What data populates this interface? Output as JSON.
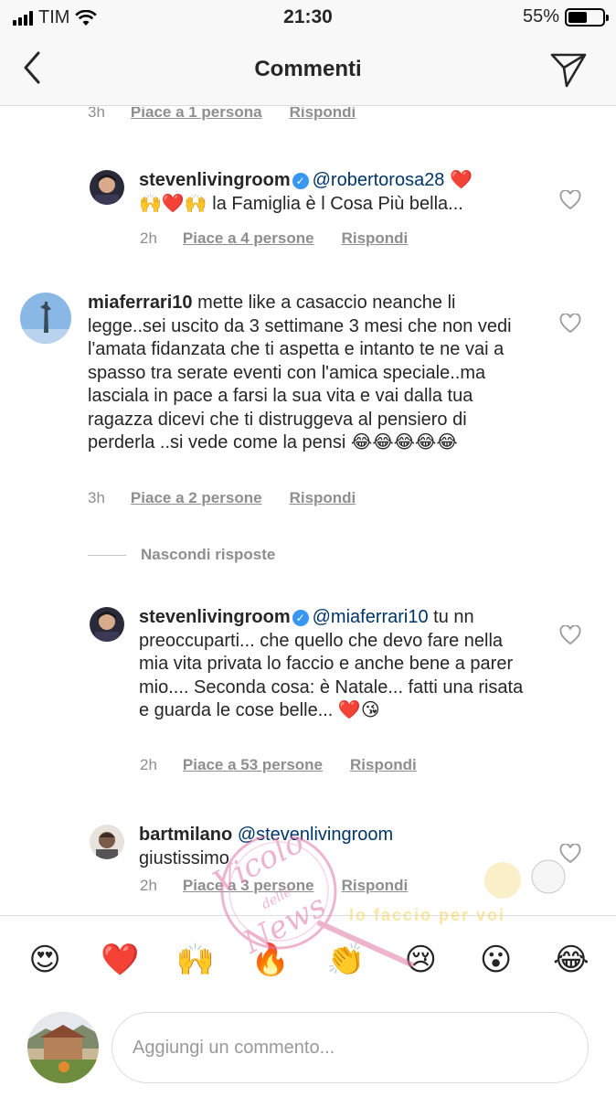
{
  "status_bar": {
    "carrier": "TIM",
    "time": "21:30",
    "battery": "55%",
    "battery_level": 0.55
  },
  "nav": {
    "title": "Commenti"
  },
  "top_meta": {
    "time": "3h",
    "likes": "Piace a 1 persona",
    "reply": "Rispondi"
  },
  "comments": [
    {
      "username": "stevenlivingroom",
      "verified": true,
      "mention": "@robertorosa28",
      "text_parts": [
        " ❤️",
        "🙌❤️🙌 la Famiglia è l Cosa Più bella..."
      ],
      "time": "2h",
      "likes": "Piace a 4 persone",
      "reply": "Rispondi"
    },
    {
      "username": "miaferrari10",
      "verified": false,
      "text": "mette like a casaccio neanche li legge..sei uscito  da 3 settimane 3 mesi che non vedi l'amata fidanzata che ti aspetta e intanto te ne vai a spasso tra serate eventi con l'amica speciale..ma lasciala in pace a farsi la sua vita e vai dalla tua ragazza dicevi  che ti distruggeva al pensiero di perderla ..si vede come  la pensi 😂😂😂😂😂",
      "time": "3h",
      "likes": "Piace a 2 persone",
      "reply": "Rispondi"
    },
    {
      "username": "stevenlivingroom",
      "verified": true,
      "mention": "@miaferrari10",
      "text": " tu nn preoccuparti... che quello che devo fare nella mia vita privata lo faccio e anche bene a parer mio.... Seconda cosa: è Natale... fatti una risata e guarda le cose belle... ❤️😘",
      "time": "2h",
      "likes": "Piace a 53 persone",
      "reply": "Rispondi"
    },
    {
      "username": "bartmilano",
      "verified": false,
      "mention": "@stevenlivingroom",
      "text": "giustissimo",
      "time": "2h",
      "likes": "Piace a 3 persone",
      "reply": "Rispondi"
    }
  ],
  "hide_replies": "Nascondi risposte",
  "emoji_bar": [
    "😍",
    "❤️",
    "🙌",
    "🔥",
    "👏",
    "😢",
    "😮",
    "😂"
  ],
  "input": {
    "placeholder": "Aggiungi un commento..."
  },
  "watermark": {
    "script": "Vicolo delle News",
    "subtitle": "lo faccio per voi"
  }
}
